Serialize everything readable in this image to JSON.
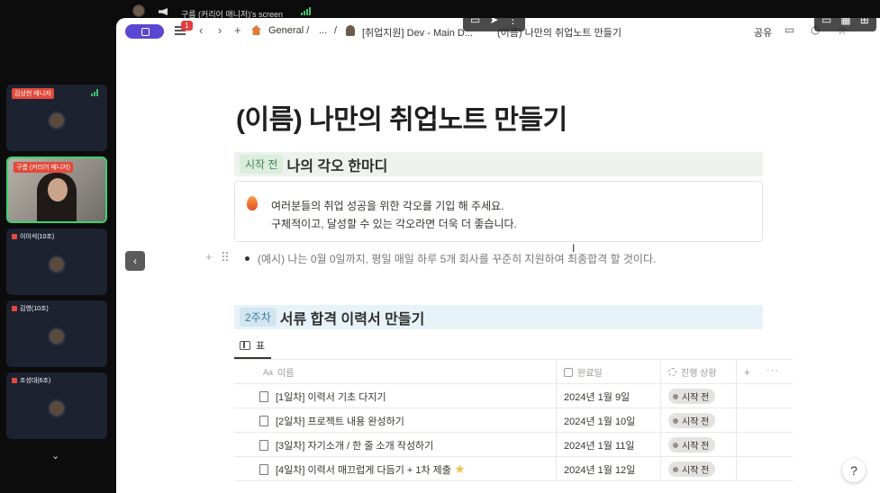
{
  "share_bar": {
    "text": "구름 (커리어 매니저)'s screen"
  },
  "participants": [
    {
      "name": "김상현 매니저",
      "muted_badge": true
    },
    {
      "name": "구름 (커리어 매니저)",
      "active": true
    },
    {
      "name": "이이석(10조)"
    },
    {
      "name": "김영(10조)"
    },
    {
      "name": "조성대(6조)"
    }
  ],
  "topbar": {
    "notif_count": "1",
    "breadcrumb_general": "General /",
    "breadcrumb_ellipsis": "...",
    "breadcrumb_sep": "/",
    "breadcrumb_workspace": "[취업지원] Dev - Main D...",
    "breadcrumb_current": "(이름) 나만의 취업노트 만들기",
    "share_label": "공유"
  },
  "page": {
    "title": "(이름) 나만의 취업노트 만들기",
    "section1": {
      "tag": "시작 전",
      "heading": "나의 각오 한마디"
    },
    "callout": {
      "line1": "여러분들의 취업 성공을 위한 각오를 기입 해 주세요.",
      "line2": "구체적이고, 달성할 수 있는 각오라면 더욱 더 좋습니다."
    },
    "bullet": "(예시) 나는 0월 0일까지, 평일 매일 하루 5개 회사를 꾸준히 지원하여 최종합격 할 것이다.",
    "section2": {
      "tag": "2주차",
      "heading": "서류 합격 이력서 만들기"
    },
    "view_tab": "표",
    "table": {
      "headers": {
        "name": "이름",
        "deadline": "완료일",
        "status": "진행 상황"
      },
      "rows": [
        {
          "name": "[1일차] 이력서 기초 다지기",
          "date": "2024년 1월 9일",
          "status": "시작 전",
          "star": false
        },
        {
          "name": "[2일차] 프로젝트 내용 완성하기",
          "date": "2024년 1월 10일",
          "status": "시작 전",
          "star": false
        },
        {
          "name": "[3일차] 자기소개 / 한 줄 소개 작성하기",
          "date": "2024년 1월 11일",
          "status": "시작 전",
          "star": false
        },
        {
          "name": "[4일차] 이력서 매끄럽게 다듬기 + 1차 제출",
          "date": "2024년 1월 12일",
          "status": "시작 전",
          "star": true
        }
      ]
    }
  },
  "help_label": "?"
}
